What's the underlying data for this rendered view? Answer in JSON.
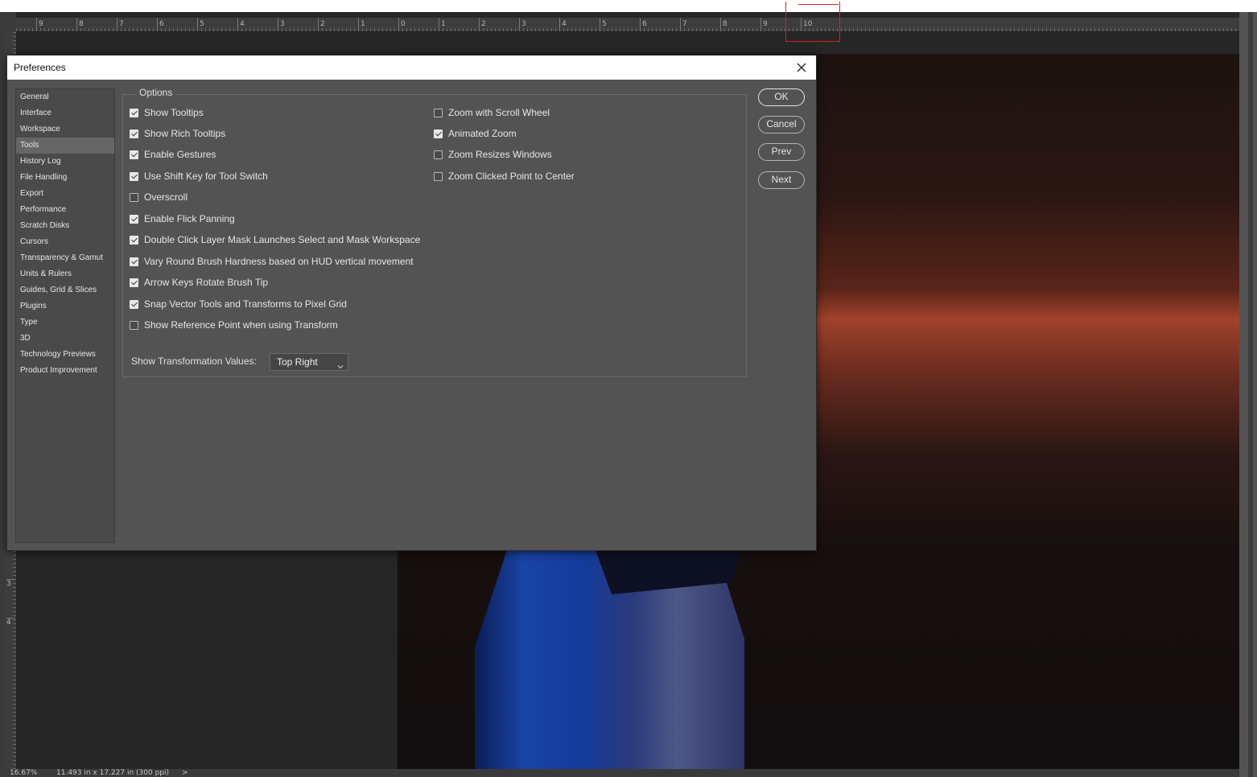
{
  "colors": {
    "dialog_bg": "#535353",
    "title_bar": "#ffffff",
    "annotation": "#d42020",
    "selected_category": "#666666"
  },
  "ruler": {
    "top_labels": [
      "9",
      "8",
      "7",
      "6",
      "5",
      "4",
      "3",
      "2",
      "1",
      "0",
      "1",
      "2",
      "3",
      "4",
      "5",
      "6",
      "7",
      "8",
      "9",
      "10"
    ],
    "left_labels": [
      "3",
      "4"
    ]
  },
  "status_bar": {
    "zoom": "16.67%",
    "doc_size": "11.493 in x 17.227 in (300 ppi)",
    "arrow": ">"
  },
  "dialog": {
    "title": "Preferences",
    "close_icon": "close-icon",
    "categories": [
      "General",
      "Interface",
      "Workspace",
      "Tools",
      "History Log",
      "File Handling",
      "Export",
      "Performance",
      "Scratch Disks",
      "Cursors",
      "Transparency & Gamut",
      "Units & Rulers",
      "Guides, Grid & Slices",
      "Plugins",
      "Type",
      "3D",
      "Technology Previews",
      "Product Improvement"
    ],
    "selected_category": "Tools",
    "options_title": "Options",
    "left_options": [
      {
        "label": "Show Tooltips",
        "checked": true
      },
      {
        "label": "Show Rich Tooltips",
        "checked": true
      },
      {
        "label": "Enable Gestures",
        "checked": true
      },
      {
        "label": "Use Shift Key for Tool Switch",
        "checked": true
      },
      {
        "label": "Overscroll",
        "checked": false
      },
      {
        "label": "Enable Flick Panning",
        "checked": true
      },
      {
        "label": "Double Click Layer Mask Launches Select and Mask Workspace",
        "checked": true
      },
      {
        "label": "Vary Round Brush Hardness based on HUD vertical movement",
        "checked": true
      },
      {
        "label": "Arrow Keys Rotate Brush Tip",
        "checked": true
      },
      {
        "label": "Snap Vector Tools and Transforms to Pixel Grid",
        "checked": true
      },
      {
        "label": "Show Reference Point when using Transform",
        "checked": false
      }
    ],
    "right_options": [
      {
        "label": "Zoom with Scroll Wheel",
        "checked": false
      },
      {
        "label": "Animated Zoom",
        "checked": true
      },
      {
        "label": "Zoom Resizes Windows",
        "checked": false
      },
      {
        "label": "Zoom Clicked Point to Center",
        "checked": false
      }
    ],
    "transform_values": {
      "label": "Show Transformation Values:",
      "selected": "Top Right",
      "chevron_icon": "chevron-down-icon"
    },
    "buttons": {
      "ok": "OK",
      "cancel": "Cancel",
      "prev": "Prev",
      "next": "Next"
    }
  }
}
